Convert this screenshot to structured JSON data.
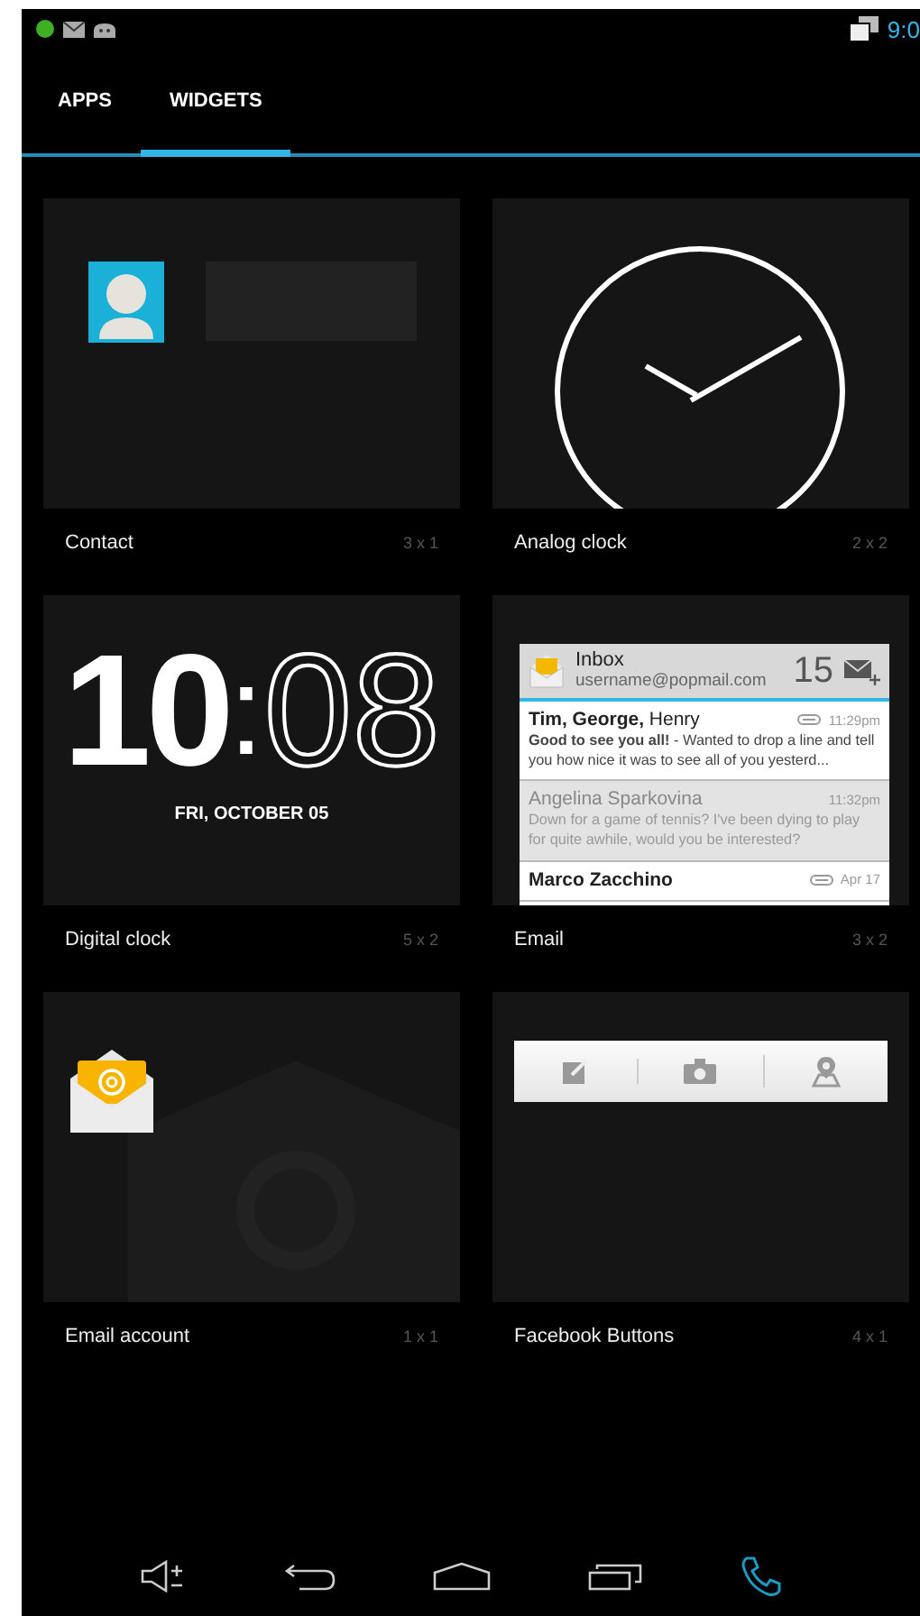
{
  "status_bar": {
    "time": "9:0"
  },
  "tabs": [
    {
      "label": "APPS",
      "selected": false
    },
    {
      "label": "WIDGETS",
      "selected": true
    }
  ],
  "widgets": [
    {
      "kind": "contact",
      "name": "Contact",
      "size": "3 x 1"
    },
    {
      "kind": "analog_clock",
      "name": "Analog clock",
      "size": "2 x 2"
    },
    {
      "kind": "digital_clock",
      "name": "Digital clock",
      "size": "5 x 2",
      "hour": "10",
      "separator": ":",
      "minute": "08",
      "date": "FRI, OCTOBER 05"
    },
    {
      "kind": "email",
      "name": "Email",
      "size": "3 x 2",
      "folder": "Inbox",
      "account": "username@popmail.com",
      "count": "15",
      "messages": [
        {
          "sender": "**Tim, George,** Henry",
          "time": "11:29pm",
          "attachment": true,
          "read": false,
          "snippet": "**Good to see you all!** - Wanted to drop a line and tell you how nice it was to see all of you yesterd..."
        },
        {
          "sender": "Angelina Sparkovina",
          "time": "11:32pm",
          "attachment": false,
          "read": true,
          "snippet": "Down for a game of tennis? I've been dying to play for quite awhile, would you be interested?"
        },
        {
          "sender": "**Marco Zacchino**",
          "time": "Apr 17",
          "attachment": true,
          "read": false
        }
      ]
    },
    {
      "kind": "email_account",
      "name": "Email account",
      "size": "1 x 1"
    },
    {
      "kind": "facebook_buttons",
      "name": "Facebook Buttons",
      "size": "4 x 1"
    }
  ]
}
